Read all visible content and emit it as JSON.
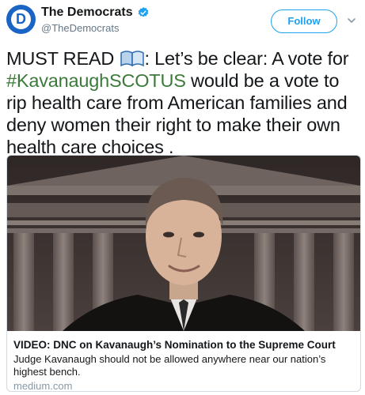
{
  "account": {
    "display_name": "The Democrats",
    "handle": "@TheDemocrats",
    "avatar_letter": "D",
    "avatar_color": "#1a64c6",
    "verified_icon": "verified-badge-icon"
  },
  "actions": {
    "follow_label": "Follow",
    "more_icon": "chevron-down-icon"
  },
  "tweet": {
    "text_before": "MUST READ ",
    "book_icon": "open-book-emoji-icon",
    "text_after_icon": ": Let’s be clear: A vote for ",
    "hashtag": "#KavanaughSCOTUS",
    "text_end": " would be a vote to rip health care from American families and deny women their right to make their own health care choices ."
  },
  "card": {
    "image_icon": "portrait-supreme-court-image",
    "title": "VIDEO: DNC on Kavanaugh’s Nomination to the Supreme Court",
    "description": "Judge Kavanaugh should not be allowed anywhere near our nation’s highest bench.",
    "domain": "medium.com"
  },
  "colors": {
    "accent": "#1da1f2",
    "hashtag": "#3b7a3a",
    "secondary_text": "#657786"
  }
}
